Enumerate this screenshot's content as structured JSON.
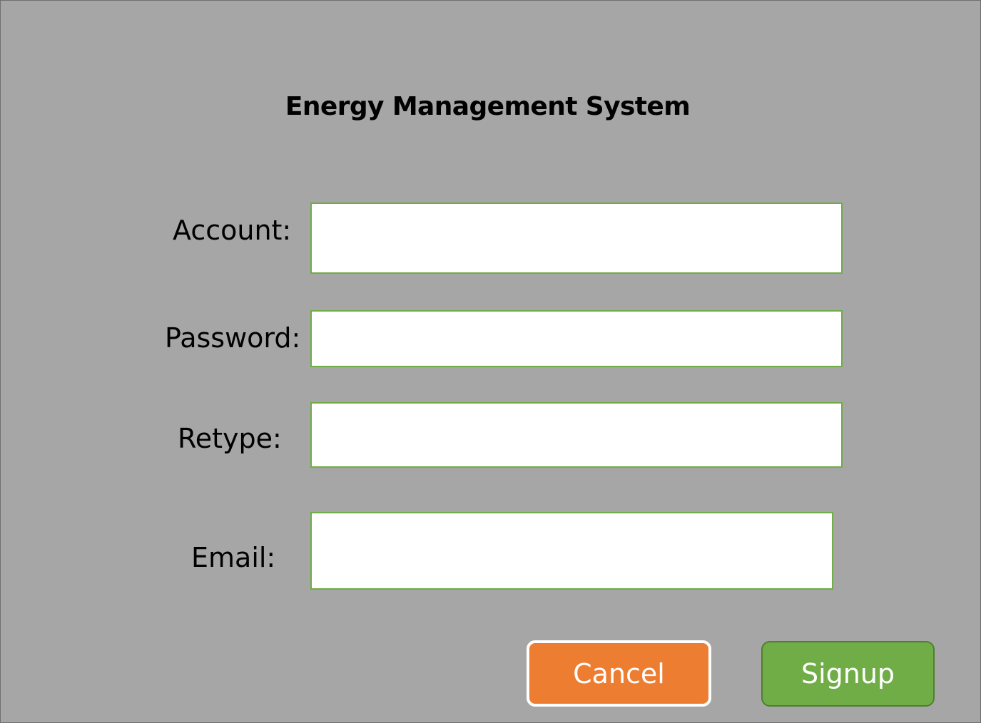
{
  "title": "Energy Management System",
  "form": {
    "account": {
      "label": "Account:",
      "value": ""
    },
    "password": {
      "label": "Password:",
      "value": ""
    },
    "retype": {
      "label": "Retype:",
      "value": ""
    },
    "email": {
      "label": "Email:",
      "value": ""
    }
  },
  "buttons": {
    "cancel": "Cancel",
    "signup": "Signup"
  },
  "colors": {
    "background": "#a6a6a6",
    "field_border": "#70ad47",
    "cancel_button": "#ed7d31",
    "signup_button": "#70ad47"
  }
}
